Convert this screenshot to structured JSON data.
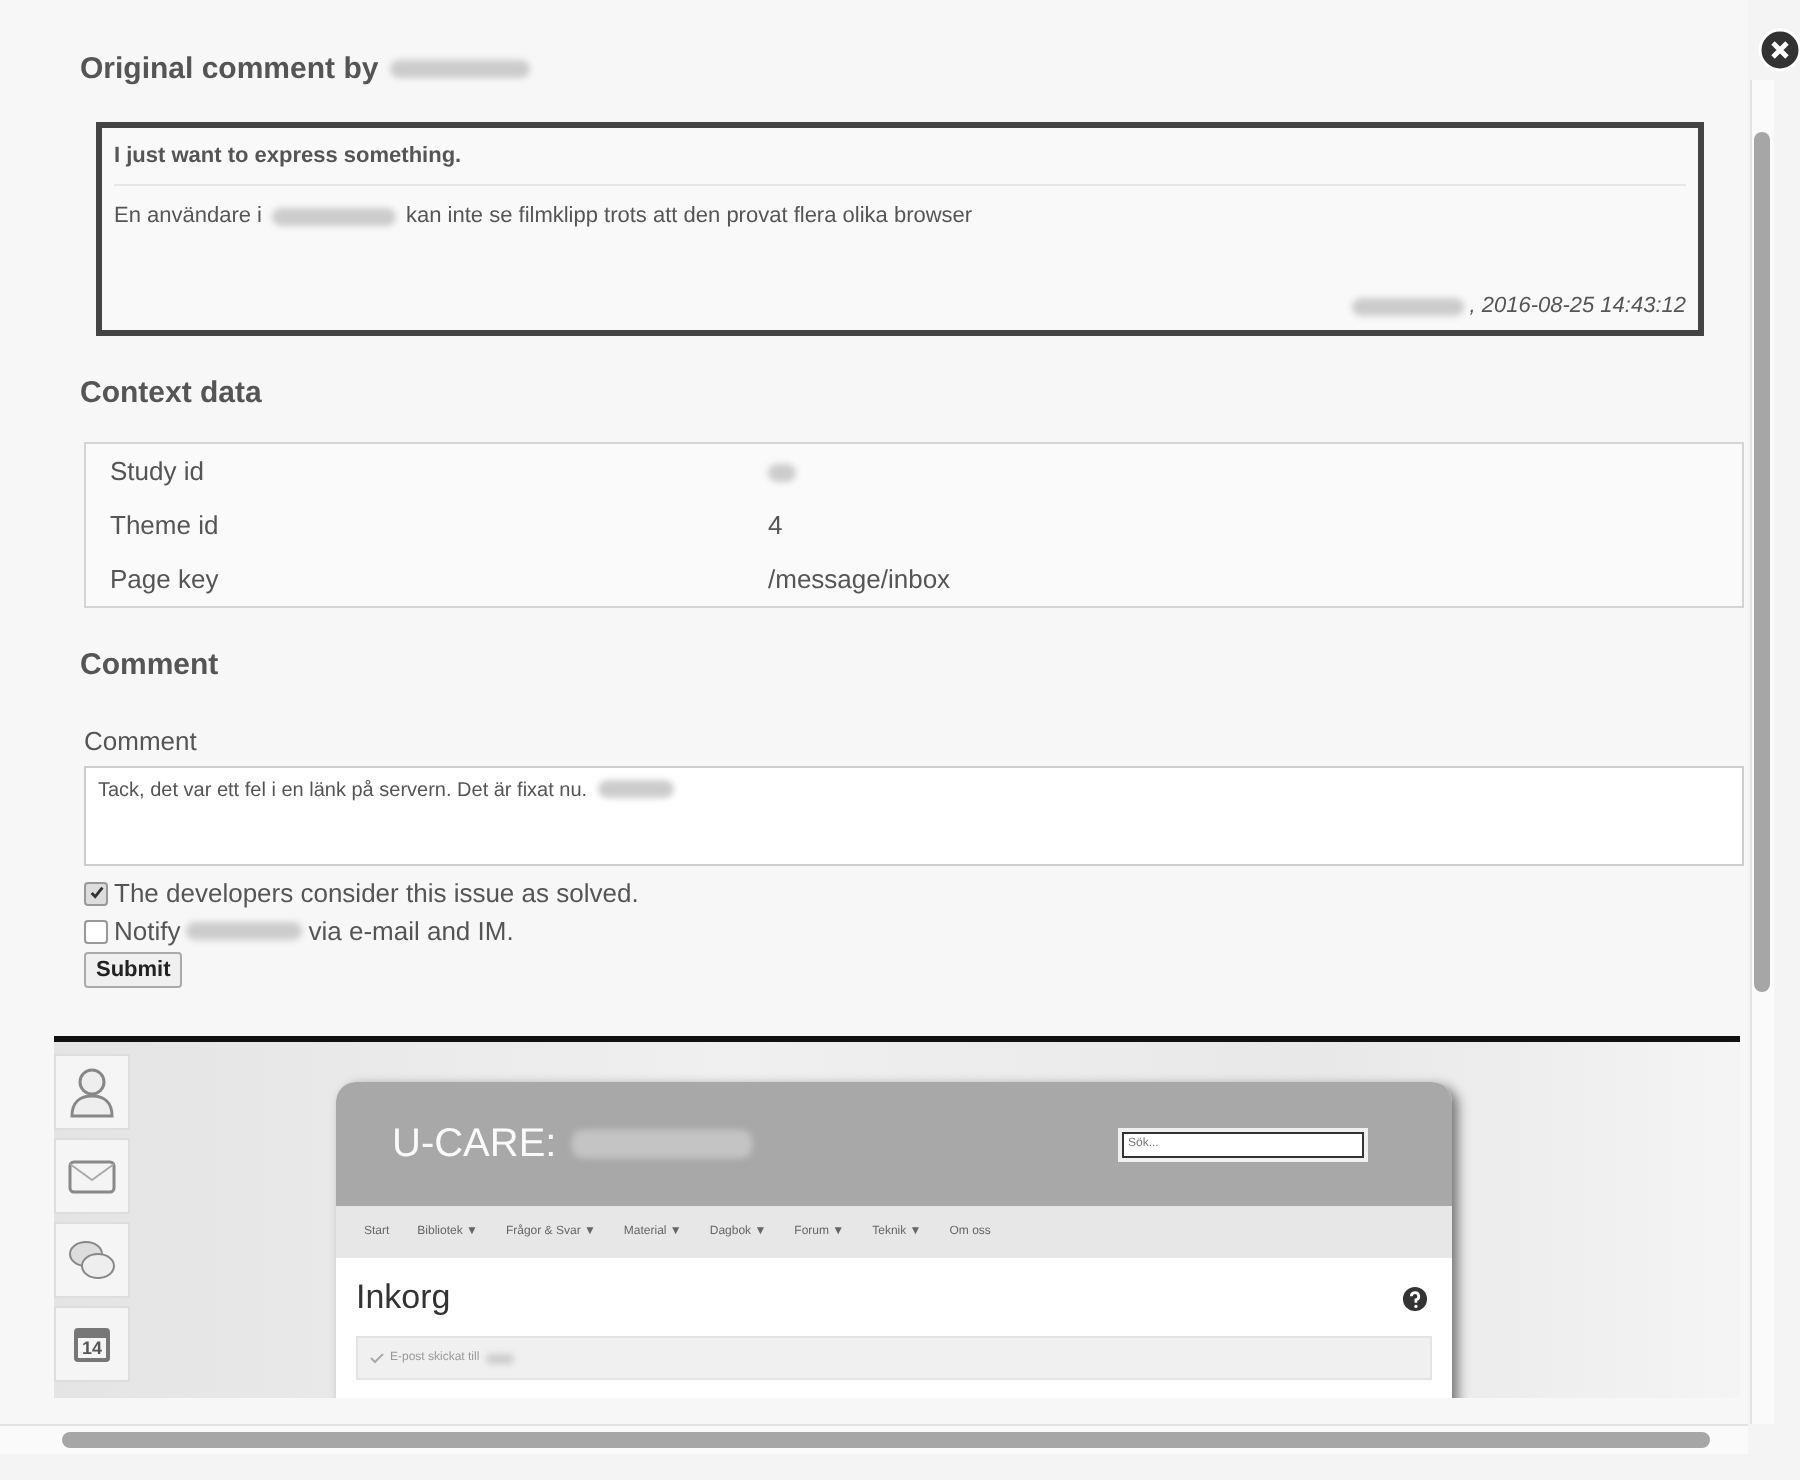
{
  "original_comment": {
    "heading": "Original comment by",
    "title": "I just want to express something.",
    "body_before": "En användare i",
    "body_after": "kan inte se filmklipp trots att den provat flera olika browser",
    "date": ", 2016-08-25 14:43:12"
  },
  "context": {
    "heading": "Context data",
    "rows": [
      {
        "label": "Study id"
      },
      {
        "label": "Theme id",
        "value": "4"
      },
      {
        "label": "Page key",
        "value": "/message/inbox"
      }
    ]
  },
  "comment": {
    "heading": "Comment",
    "field_label": "Comment",
    "value": "Tack, det var ett fel i en länk på servern. Det är fixat nu.",
    "options": [
      {
        "label_before": "The developers consider this issue as solved.",
        "checked": true
      },
      {
        "label_before": "Notify",
        "label_after": "via e-mail and IM.",
        "checked": false
      }
    ],
    "submit": "Submit"
  },
  "screenshot": {
    "brand": "U-CARE:",
    "search_placeholder": "Sök...",
    "calendar_day": "14",
    "nav": [
      "Start",
      "Bibliotek ▼",
      "Frågor & Svar ▼",
      "Material ▼",
      "Dagbok ▼",
      "Forum ▼",
      "Teknik ▼",
      "Om oss"
    ],
    "page_title": "Inkorg",
    "notice": "E-post skickat till"
  }
}
